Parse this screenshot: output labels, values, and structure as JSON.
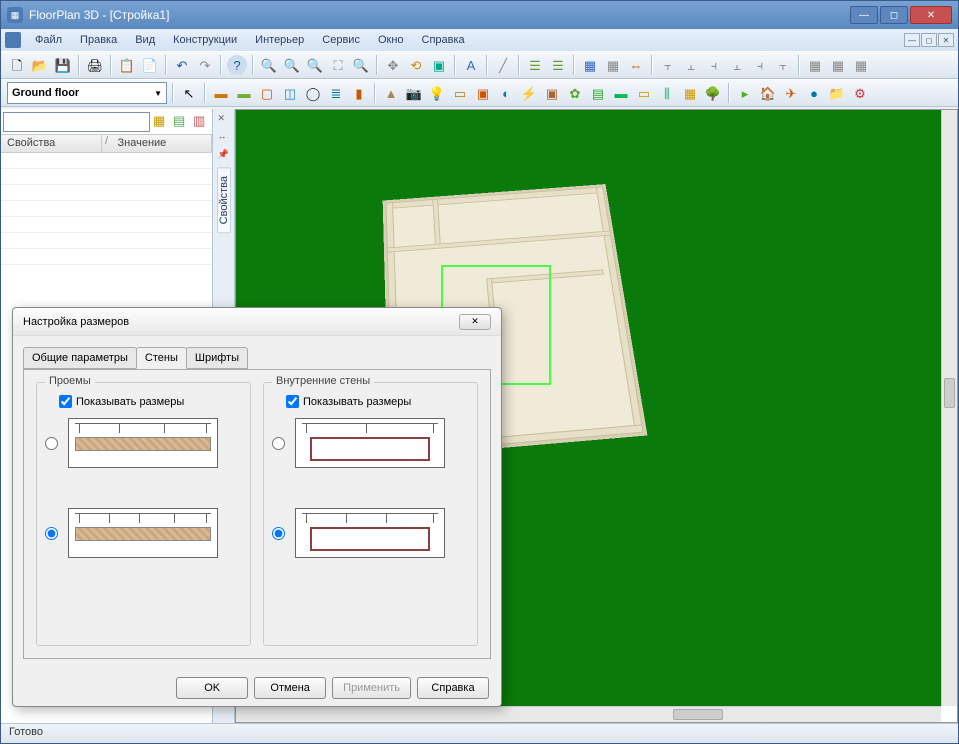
{
  "app": {
    "title": "FloorPlan 3D - [Стройка1]"
  },
  "menu": {
    "items": [
      "Файл",
      "Правка",
      "Вид",
      "Конструкции",
      "Интерьер",
      "Сервис",
      "Окно",
      "Справка"
    ]
  },
  "floor_selector": {
    "value": "Ground floor"
  },
  "properties_panel": {
    "columns": [
      "Свойства",
      "Значение"
    ],
    "divider": "/",
    "tab_label": "Свойства"
  },
  "statusbar": {
    "text": "Готово"
  },
  "dialog": {
    "title": "Настройка размеров",
    "tabs": [
      "Общие параметры",
      "Стены",
      "Шрифты"
    ],
    "active_tab": 1,
    "groups": {
      "openings": {
        "legend": "Проемы",
        "checkbox_label": "Показывать размеры",
        "checkbox_checked": true,
        "selected_option": 1
      },
      "inner_walls": {
        "legend": "Внутренние стены",
        "checkbox_label": "Показывать размеры",
        "checkbox_checked": true,
        "selected_option": 1
      }
    },
    "buttons": {
      "ok": "OK",
      "cancel": "Отмена",
      "apply": "Применить",
      "help": "Справка"
    }
  },
  "icons": {
    "new": "🗋",
    "open": "📂",
    "save": "💾",
    "print": "🖨",
    "copy": "📋",
    "paste": "📄",
    "undo": "↶",
    "redo": "↷",
    "help": "?",
    "zoomin": "🔍",
    "zoomout": "🔍",
    "zoomfit": "⛶",
    "pan": "✥",
    "rotate": "⟲",
    "3d": "▣",
    "layers": "☰",
    "grid": "▦",
    "settings": "⚙",
    "arrow": "↖",
    "wall": "▬",
    "door": "▢",
    "window": "◫",
    "roof": "▲",
    "stairs": "≣",
    "column": "▮",
    "camera": "📷",
    "light": "💡",
    "tree": "🌳",
    "fence": "⫼",
    "texture": "▤"
  }
}
